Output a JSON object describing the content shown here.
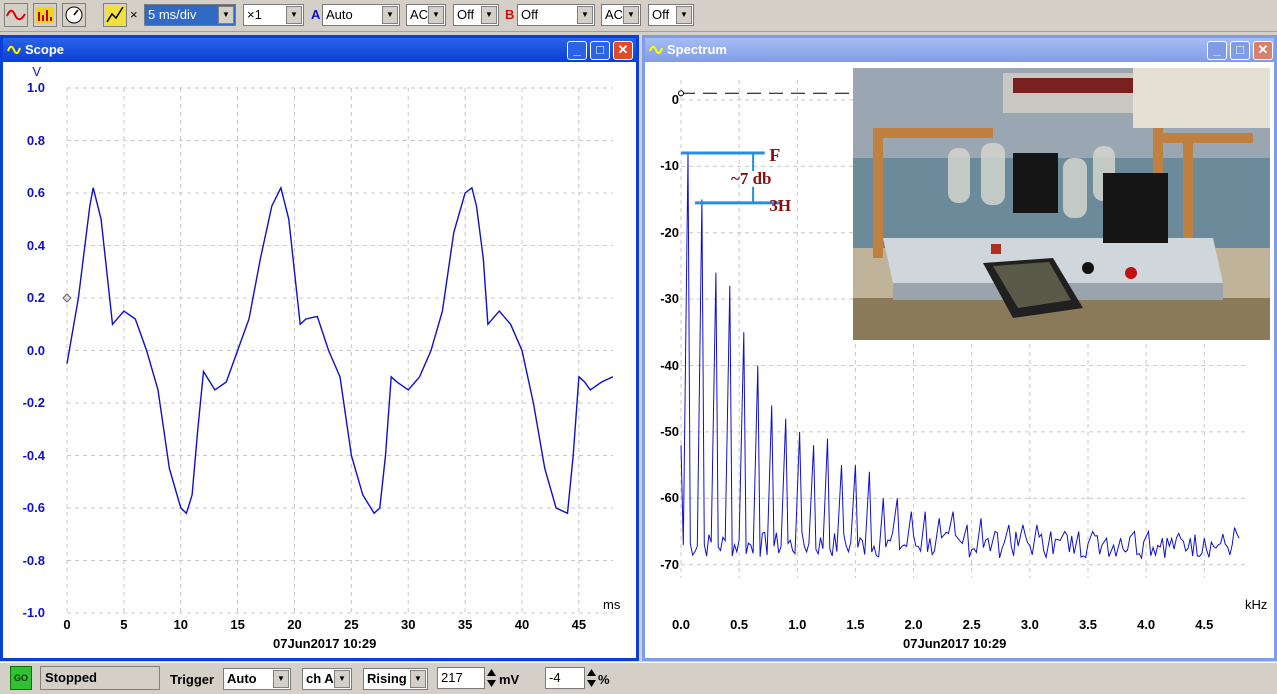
{
  "toolbar": {
    "timebase": "5 ms/div",
    "multiplier": "×1",
    "channel_a": {
      "label": "A",
      "range": "Auto",
      "coupling": "AC",
      "offset": "Off",
      "color": "#1010c0"
    },
    "channel_b": {
      "label": "B",
      "range": "Off",
      "coupling": "AC",
      "offset": "Off",
      "color": "#d01010"
    },
    "x_label": "×"
  },
  "scope": {
    "title": "Scope",
    "y_unit": "V",
    "x_unit": "ms",
    "y_ticks": [
      "1.0",
      "0.8",
      "0.6",
      "0.4",
      "0.2",
      "0.0",
      "-0.2",
      "-0.4",
      "-0.6",
      "-0.8",
      "-1.0"
    ],
    "x_ticks": [
      "0",
      "5",
      "10",
      "15",
      "20",
      "25",
      "30",
      "35",
      "40",
      "45"
    ],
    "timestamp": "07Jun2017  10:29",
    "trace_color": "#1010c8"
  },
  "spectrum": {
    "title": "Spectrum",
    "x_unit": "kHz",
    "y_ticks": [
      "0",
      "-10",
      "-20",
      "-30",
      "-40",
      "-50",
      "-60",
      "-70"
    ],
    "x_ticks": [
      "0.0",
      "0.5",
      "1.0",
      "1.5",
      "2.0",
      "2.5",
      "3.0",
      "3.5",
      "4.0",
      "4.5"
    ],
    "timestamp": "07Jun2017  10:29",
    "annotations": {
      "fundamental": "F",
      "third": "3H",
      "difference": "~7 db"
    },
    "trace_color": "#1010c8"
  },
  "status": {
    "go_label": "GO",
    "state": "Stopped",
    "trigger_label": "Trigger",
    "trigger_mode": "Auto",
    "trigger_channel": "ch A",
    "trigger_edge": "Rising",
    "trigger_level": "217",
    "level_unit": "mV",
    "pretrigger": "-4",
    "pretrigger_unit": "%"
  },
  "chart_data": [
    {
      "type": "line",
      "title": "Scope",
      "xlabel": "ms",
      "ylabel": "V",
      "ylim": [
        -1.0,
        1.0
      ],
      "xlim": [
        0,
        48
      ],
      "grid": true,
      "series": [
        {
          "x": [
            0,
            1,
            2,
            2.3,
            3,
            3.5,
            4,
            5,
            6,
            7,
            8,
            9,
            10,
            10.5,
            11,
            11.5,
            12,
            13,
            14,
            15,
            16,
            17,
            18,
            18.8,
            19.5,
            20,
            20.5,
            21,
            22,
            23,
            24,
            25,
            26,
            27,
            27.5,
            28,
            28.5,
            29,
            30,
            31,
            32,
            33,
            34,
            35,
            35.6,
            36,
            36.6,
            37,
            38,
            39,
            40,
            41,
            42,
            43,
            44,
            44.5,
            45,
            45.5,
            46,
            47,
            48
          ],
          "y": [
            -0.05,
            0.2,
            0.55,
            0.62,
            0.5,
            0.3,
            0.1,
            0.15,
            0.12,
            0.0,
            -0.15,
            -0.45,
            -0.6,
            -0.62,
            -0.55,
            -0.3,
            -0.08,
            -0.15,
            -0.12,
            0.0,
            0.12,
            0.35,
            0.55,
            0.62,
            0.5,
            0.3,
            0.1,
            0.12,
            0.13,
            0.0,
            -0.1,
            -0.4,
            -0.55,
            -0.62,
            -0.6,
            -0.4,
            -0.1,
            -0.12,
            -0.15,
            -0.1,
            0.0,
            0.15,
            0.45,
            0.6,
            0.62,
            0.55,
            0.35,
            0.1,
            0.15,
            0.1,
            0.0,
            -0.2,
            -0.45,
            -0.6,
            -0.62,
            -0.4,
            -0.1,
            -0.12,
            -0.15,
            -0.12,
            -0.1
          ]
        }
      ]
    },
    {
      "type": "line",
      "title": "Spectrum",
      "xlabel": "kHz",
      "ylabel": "",
      "ylim": [
        -72,
        3
      ],
      "xlim": [
        0,
        4.85
      ],
      "grid": true,
      "harmonic_peaks": [
        [
          0.06,
          -8
        ],
        [
          0.18,
          -15
        ],
        [
          0.3,
          -26
        ],
        [
          0.42,
          -28
        ],
        [
          0.54,
          -35
        ],
        [
          0.66,
          -40
        ],
        [
          0.78,
          -46
        ],
        [
          0.9,
          -48
        ],
        [
          1.02,
          -50
        ],
        [
          1.14,
          -52
        ],
        [
          1.26,
          -51
        ],
        [
          1.38,
          -55
        ],
        [
          1.5,
          -55
        ],
        [
          1.62,
          -56
        ],
        [
          1.74,
          -60
        ],
        [
          1.86,
          -60
        ],
        [
          1.98,
          -62
        ],
        [
          2.1,
          -62
        ],
        [
          2.22,
          -63
        ],
        [
          2.34,
          -62
        ],
        [
          2.46,
          -64
        ],
        [
          2.58,
          -63
        ],
        [
          2.7,
          -65
        ],
        [
          2.82,
          -64
        ],
        [
          2.94,
          -64
        ],
        [
          3.06,
          -64
        ],
        [
          3.18,
          -65
        ],
        [
          3.3,
          -65
        ],
        [
          3.42,
          -65
        ],
        [
          3.54,
          -65
        ],
        [
          3.66,
          -66
        ],
        [
          3.78,
          -66
        ],
        [
          3.9,
          -65
        ],
        [
          4.02,
          -65
        ],
        [
          4.14,
          -66
        ],
        [
          4.26,
          -66
        ],
        [
          4.38,
          -66
        ],
        [
          4.5,
          -66
        ],
        [
          4.62,
          -67
        ],
        [
          4.74,
          -67
        ]
      ],
      "noise_floor_db": -67
    }
  ]
}
